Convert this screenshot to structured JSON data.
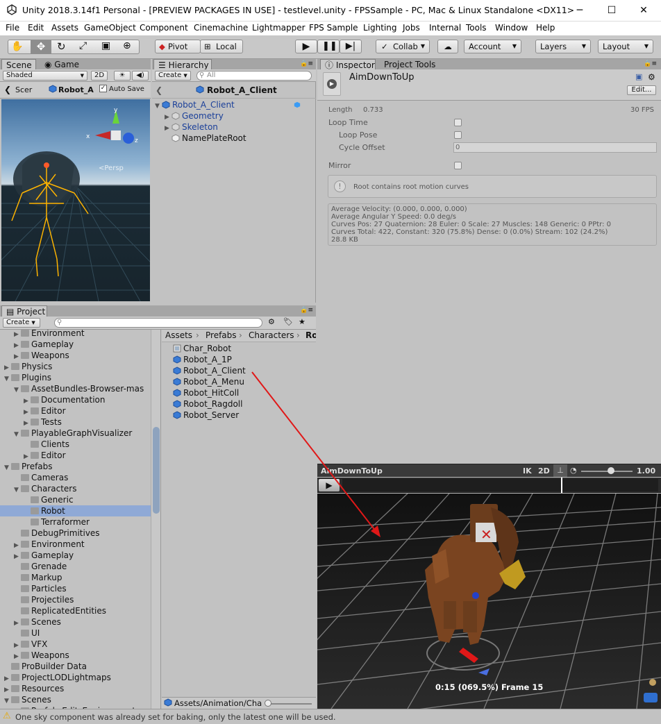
{
  "window": {
    "title": "Unity 2018.3.14f1 Personal - [PREVIEW PACKAGES IN USE] - testlevel.unity - FPSSample - PC, Mac & Linux Standalone <DX11>",
    "minimize": "─",
    "maximize": "☐",
    "close": "✕"
  },
  "menu": [
    "File",
    "Edit",
    "Assets",
    "GameObject",
    "Component",
    "Cinemachine",
    "Lightmapper",
    "FPS Sample",
    "Lighting",
    "Jobs",
    "Internal",
    "Tools",
    "Window",
    "Help"
  ],
  "toolbar": {
    "pivot": "Pivot",
    "local": "Local",
    "collab": "Collab",
    "account": "Account",
    "layers": "Layers",
    "layout": "Layout"
  },
  "scene": {
    "tab_scene": "Scene",
    "tab_game": "Game",
    "shading": "Shaded",
    "mode_2d": "2D",
    "scene_label": "Scer",
    "object_label": "Robot_A",
    "auto_save": "Auto Save",
    "persp": "<Persp"
  },
  "hierarchy": {
    "tab": "Hierarchy",
    "create": "Create",
    "search_placeholder": "All",
    "title": "Robot_A_Client",
    "items": [
      "Robot_A_Client",
      "Geometry",
      "Skeleton",
      "NamePlateRoot"
    ]
  },
  "inspector": {
    "tab_inspector": "Inspector",
    "tab_project_tools": "Project Tools",
    "asset_name": "AimDownToUp",
    "edit_button": "Edit...",
    "length_label": "Length",
    "length_value": "0.733",
    "fps": "30 FPS",
    "loop_time": "Loop Time",
    "loop_pose": "Loop Pose",
    "cycle_offset": "Cycle Offset",
    "cycle_offset_value": "0",
    "mirror": "Mirror",
    "info_text": "Root contains root motion curves",
    "stats": [
      "Average Velocity: (0.000, 0.000, 0.000)",
      "Average Angular Y Speed: 0.0 deg/s",
      "Curves Pos: 27 Quaternion: 28 Euler: 0 Scale: 27 Muscles: 148 Generic: 0 PPtr: 0",
      "Curves Total: 422, Constant: 320 (75.8%) Dense: 0 (0.0%) Stream: 102 (24.2%)",
      "28.8 KB"
    ]
  },
  "preview": {
    "clip_name": "AimDownToUp",
    "ik": "IK",
    "mode_2d": "2D",
    "speed": "1.00",
    "time_readout": "0:15 (069.5%) Frame 15",
    "playhead_fraction": 0.695
  },
  "project": {
    "tab": "Project",
    "create": "Create",
    "tree": [
      {
        "label": "Environment",
        "indent": 2,
        "arrow": true
      },
      {
        "label": "Gameplay",
        "indent": 2,
        "arrow": true
      },
      {
        "label": "Weapons",
        "indent": 2,
        "arrow": true
      },
      {
        "label": "Physics",
        "indent": 1,
        "arrow": true
      },
      {
        "label": "Plugins",
        "indent": 1,
        "arrow": true,
        "open": true
      },
      {
        "label": "AssetBundles-Browser-mas",
        "indent": 2,
        "arrow": true,
        "open": true
      },
      {
        "label": "Documentation",
        "indent": 3,
        "arrow": true
      },
      {
        "label": "Editor",
        "indent": 3,
        "arrow": true
      },
      {
        "label": "Tests",
        "indent": 3,
        "arrow": true
      },
      {
        "label": "PlayableGraphVisualizer",
        "indent": 2,
        "arrow": true,
        "open": true
      },
      {
        "label": "Clients",
        "indent": 3,
        "arrow": false
      },
      {
        "label": "Editor",
        "indent": 3,
        "arrow": true
      },
      {
        "label": "Prefabs",
        "indent": 1,
        "arrow": true,
        "open": true
      },
      {
        "label": "Cameras",
        "indent": 2,
        "arrow": false
      },
      {
        "label": "Characters",
        "indent": 2,
        "arrow": true,
        "open": true
      },
      {
        "label": "Generic",
        "indent": 3,
        "arrow": false
      },
      {
        "label": "Robot",
        "indent": 3,
        "arrow": false,
        "selected": true
      },
      {
        "label": "Terraformer",
        "indent": 3,
        "arrow": false
      },
      {
        "label": "DebugPrimitives",
        "indent": 2,
        "arrow": false
      },
      {
        "label": "Environment",
        "indent": 2,
        "arrow": true
      },
      {
        "label": "Gameplay",
        "indent": 2,
        "arrow": true
      },
      {
        "label": "Grenade",
        "indent": 2,
        "arrow": false
      },
      {
        "label": "Markup",
        "indent": 2,
        "arrow": false
      },
      {
        "label": "Particles",
        "indent": 2,
        "arrow": false
      },
      {
        "label": "Projectiles",
        "indent": 2,
        "arrow": false
      },
      {
        "label": "ReplicatedEntities",
        "indent": 2,
        "arrow": false
      },
      {
        "label": "Scenes",
        "indent": 2,
        "arrow": true
      },
      {
        "label": "UI",
        "indent": 2,
        "arrow": false
      },
      {
        "label": "VFX",
        "indent": 2,
        "arrow": true
      },
      {
        "label": "Weapons",
        "indent": 2,
        "arrow": true
      },
      {
        "label": "ProBuilder Data",
        "indent": 1,
        "arrow": false
      },
      {
        "label": "ProjectLODLightmaps",
        "indent": 1,
        "arrow": true
      },
      {
        "label": "Resources",
        "indent": 1,
        "arrow": true
      },
      {
        "label": "Scenes",
        "indent": 1,
        "arrow": true,
        "open": true
      },
      {
        "label": "Prefab_Edit_Environment",
        "indent": 2,
        "arrow": false
      }
    ],
    "breadcrumb": [
      "Assets",
      "Prefabs",
      "Characters",
      "Ro"
    ],
    "assets": [
      "Char_Robot",
      "Robot_A_1P",
      "Robot_A_Client",
      "Robot_A_Menu",
      "Robot_HitColl",
      "Robot_Ragdoll",
      "Robot_Server"
    ],
    "footer_path": "Assets/Animation/Cha"
  },
  "status": {
    "message": "One sky component was already set for baking, only the latest one will be used."
  },
  "colors": {
    "accent_selection": "#8fa9d6",
    "prefab_blue": "#2a5fbf",
    "arrow_red": "#e01818"
  }
}
